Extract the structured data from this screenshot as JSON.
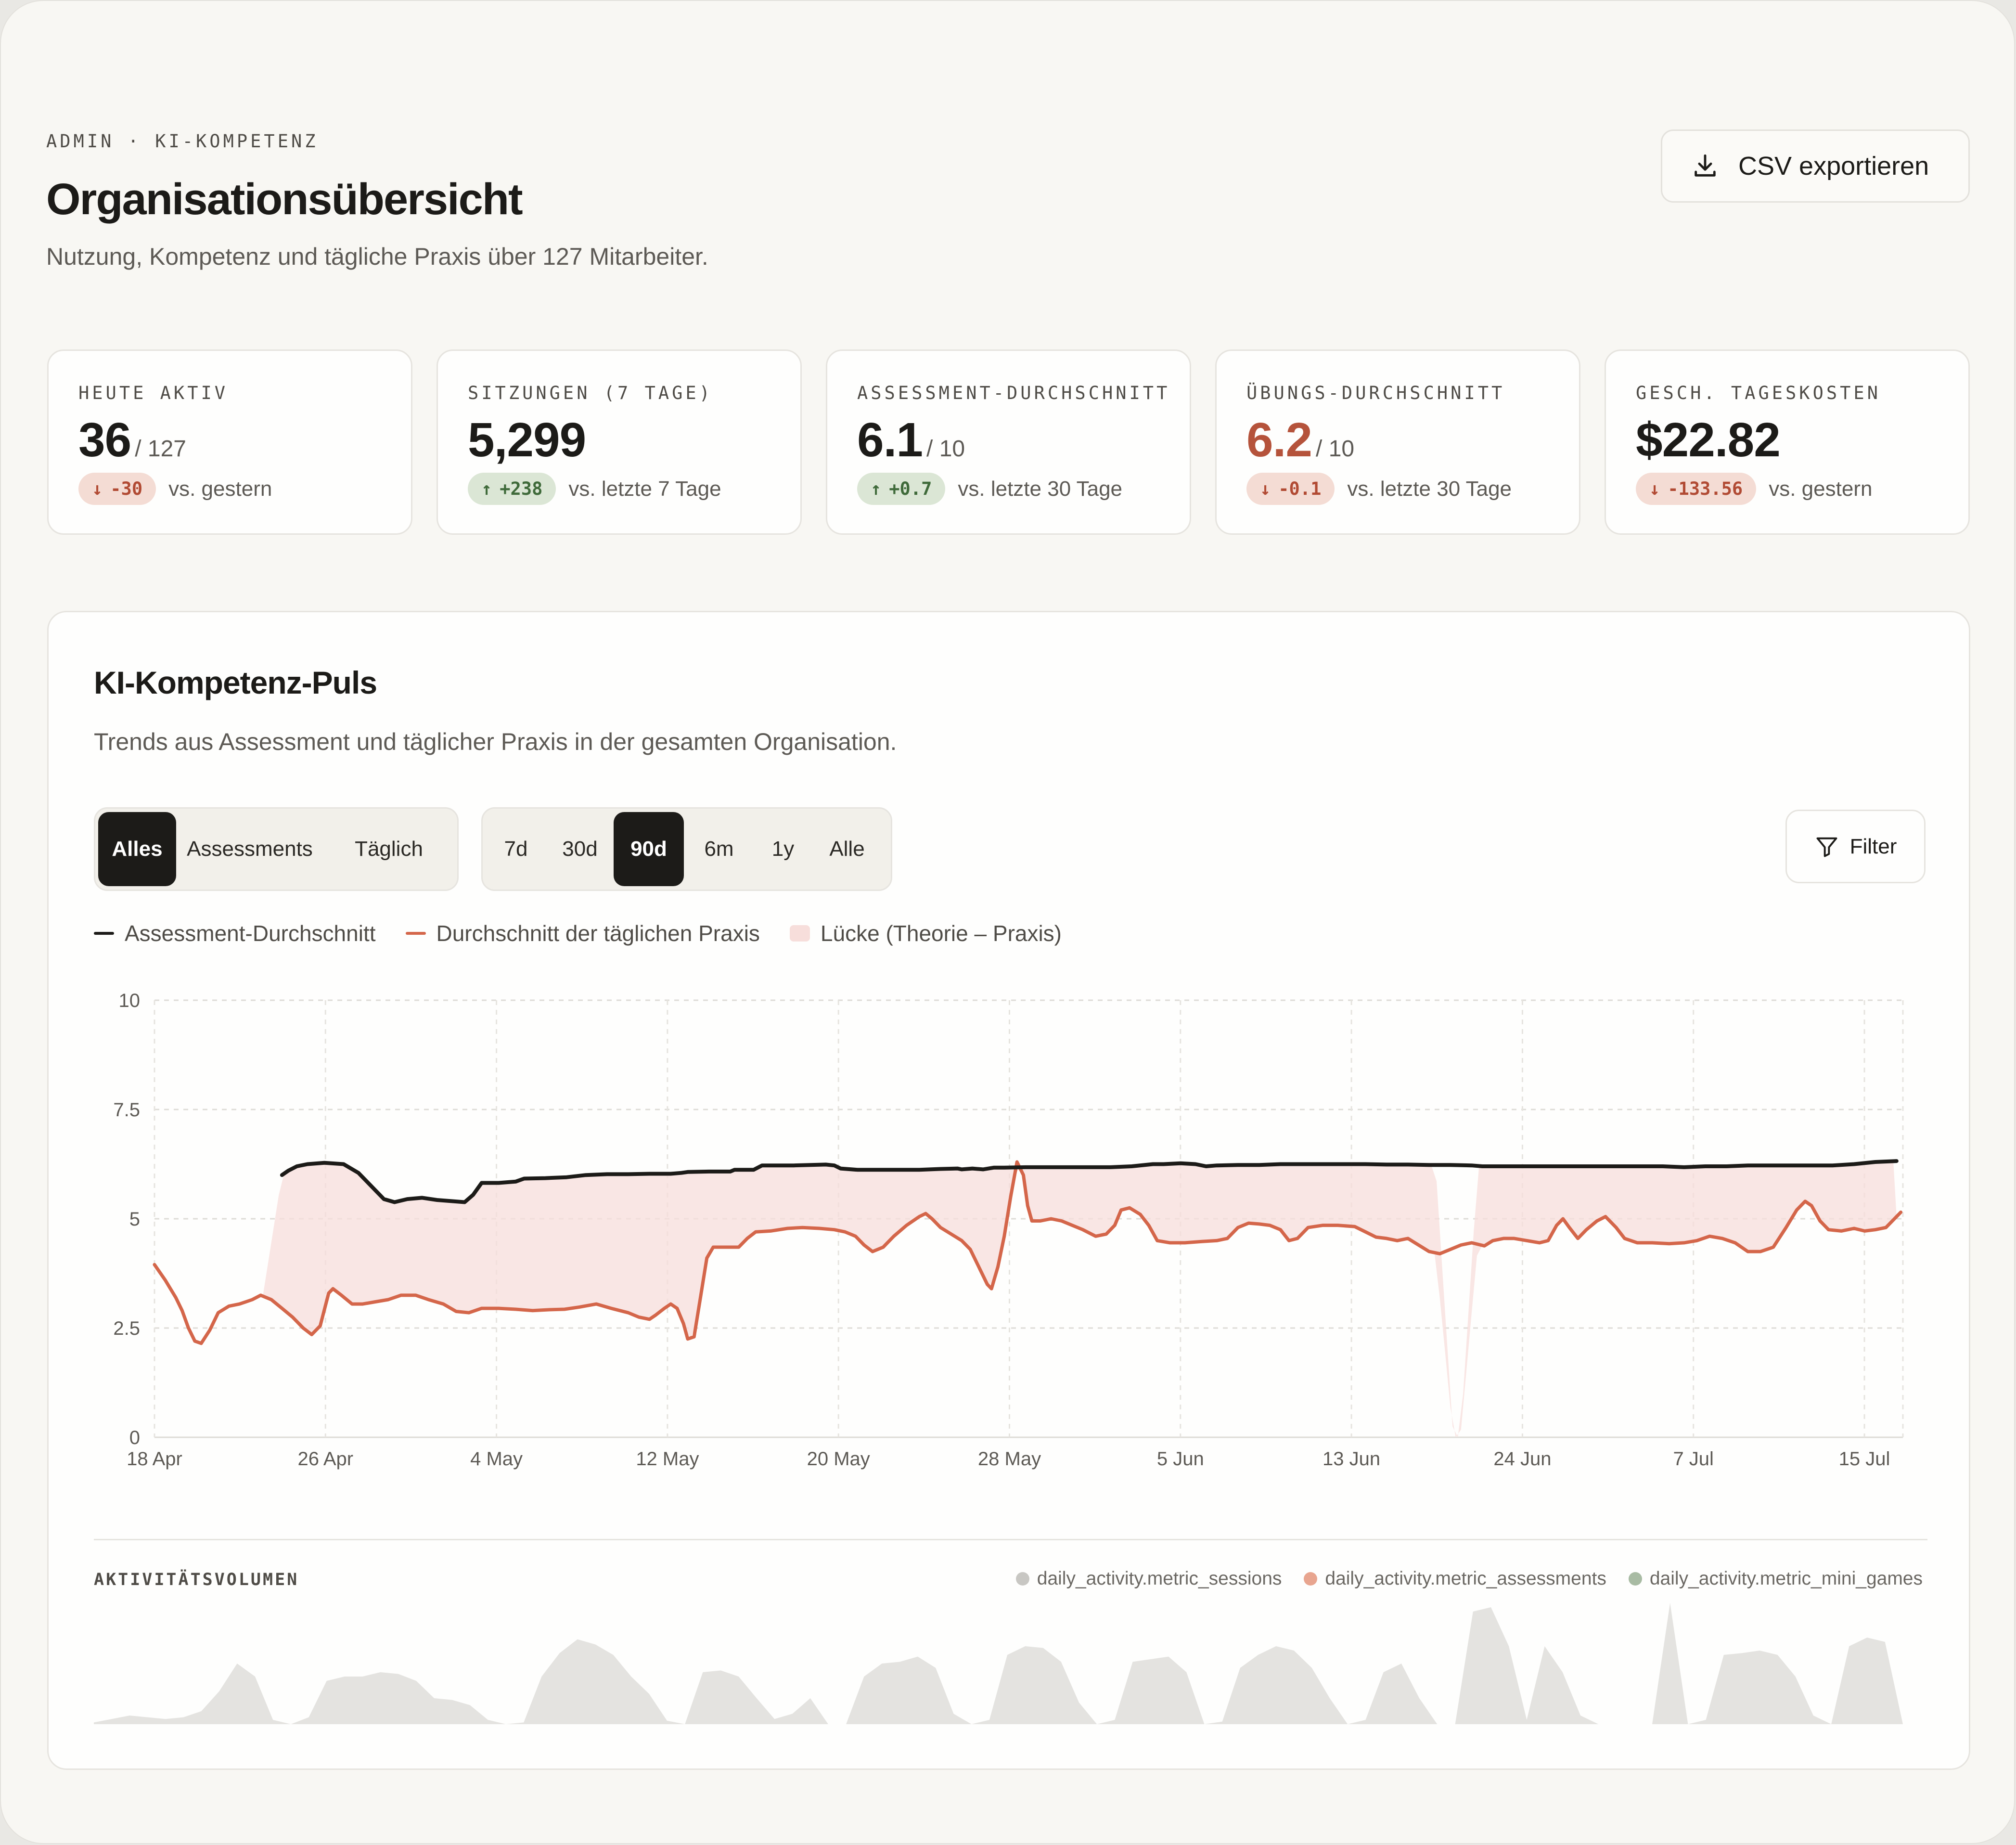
{
  "header": {
    "eyebrow": "ADMIN · KI-KOMPETENZ",
    "title": "Organisationsübersicht",
    "subtitle": "Nutzung, Kompetenz und tägliche Praxis über 127 Mitarbeiter.",
    "export_label": "CSV exportieren"
  },
  "kpis": [
    {
      "label": "HEUTE AKTIV",
      "value": "36",
      "denom": "/ 127",
      "delta": "-30",
      "direction": "down",
      "compare": "vs. gestern"
    },
    {
      "label": "SITZUNGEN (7 TAGE)",
      "value": "5,299",
      "denom": "",
      "delta": "+238",
      "direction": "up",
      "compare": "vs. letzte 7 Tage"
    },
    {
      "label": "ASSESSMENT-DURCHSCHNITT",
      "value": "6.1",
      "denom": "/ 10",
      "delta": "+0.7",
      "direction": "up",
      "compare": "vs. letzte 30 Tage"
    },
    {
      "label": "ÜBUNGS-DURCHSCHNITT",
      "value": "6.2",
      "denom": "/ 10",
      "delta": "-0.1",
      "direction": "down",
      "compare": "vs. letzte 30 Tage"
    },
    {
      "label": "GESCH. TAGESKOSTEN",
      "value": "$22.82",
      "denom": "",
      "delta": "-133.56",
      "direction": "down",
      "compare": "vs. gestern"
    }
  ],
  "colors": {
    "assessment_line": "#1c1b18",
    "practice_line": "#d4664a",
    "gap_fill": "#f7dedb",
    "warn_value": "#b5533b",
    "activity_fill": "#e4e3e0"
  },
  "panel": {
    "title": "KI-Kompetenz-Puls",
    "subtitle": "Trends aus Assessment und täglicher Praxis in der gesamten Organisation.",
    "type_filters": [
      "Alles",
      "Assessments",
      "Täglich"
    ],
    "type_active": "Alles",
    "range_filters": [
      "7d",
      "30d",
      "90d",
      "6m",
      "1y",
      "Alle"
    ],
    "range_active": "90d",
    "filter_label": "Filter",
    "legend": [
      "Assessment-Durchschnitt",
      "Durchschnitt der täglichen Praxis",
      "Lücke (Theorie – Praxis)"
    ],
    "activity_title": "AKTIVITÄTSVOLUMEN",
    "activity_legend": [
      "daily_activity.metric_sessions",
      "daily_activity.metric_assessments",
      "daily_activity.metric_mini_games"
    ],
    "activity_legend_colors": [
      "#c8c7c3",
      "#e8a58f",
      "#a8bba3"
    ]
  },
  "chart_data": {
    "type": "line",
    "y_ticks": [
      "0",
      "2.5",
      "5",
      "7.5",
      "10"
    ],
    "ylim": [
      0,
      10
    ],
    "x_ticks": [
      "18 Apr",
      "26 Apr",
      "4 May",
      "12 May",
      "20 May",
      "28 May",
      "5 Jun",
      "13 Jun",
      "24 Jun",
      "7 Jul",
      "15 Jul"
    ],
    "x_range_days": [
      0,
      82.3
    ],
    "grid": true,
    "series": [
      {
        "name": "Assessment-Durchschnitt",
        "points": [
          [
            6.0,
            6.0
          ],
          [
            6.3,
            6.1
          ],
          [
            6.7,
            6.2
          ],
          [
            7.2,
            6.25
          ],
          [
            8.0,
            6.28
          ],
          [
            8.9,
            6.25
          ],
          [
            9.6,
            6.05
          ],
          [
            10.2,
            5.75
          ],
          [
            10.8,
            5.45
          ],
          [
            11.3,
            5.38
          ],
          [
            11.9,
            5.45
          ],
          [
            12.6,
            5.48
          ],
          [
            13.3,
            5.43
          ],
          [
            14.1,
            5.4
          ],
          [
            14.6,
            5.38
          ],
          [
            15.0,
            5.55
          ],
          [
            15.4,
            5.82
          ],
          [
            16.2,
            5.82
          ],
          [
            17.0,
            5.85
          ],
          [
            17.4,
            5.92
          ],
          [
            18.4,
            5.93
          ],
          [
            19.4,
            5.95
          ],
          [
            20.3,
            6.0
          ],
          [
            21.3,
            6.02
          ],
          [
            22.3,
            6.02
          ],
          [
            23.3,
            6.03
          ],
          [
            24.3,
            6.03
          ],
          [
            24.8,
            6.05
          ],
          [
            25.1,
            6.07
          ],
          [
            26.1,
            6.08
          ],
          [
            27.1,
            6.08
          ],
          [
            27.3,
            6.12
          ],
          [
            28.2,
            6.12
          ],
          [
            28.6,
            6.22
          ],
          [
            30.1,
            6.22
          ],
          [
            31.6,
            6.24
          ],
          [
            32.0,
            6.22
          ],
          [
            32.3,
            6.15
          ],
          [
            33.1,
            6.12
          ],
          [
            34.1,
            6.12
          ],
          [
            35.1,
            6.12
          ],
          [
            36.0,
            6.12
          ],
          [
            37.0,
            6.14
          ],
          [
            37.8,
            6.15
          ],
          [
            38.0,
            6.13
          ],
          [
            38.5,
            6.15
          ],
          [
            39.0,
            6.13
          ],
          [
            39.5,
            6.17
          ],
          [
            40.0,
            6.17
          ],
          [
            41.0,
            6.18
          ],
          [
            42.0,
            6.18
          ],
          [
            43.0,
            6.18
          ],
          [
            44.0,
            6.18
          ],
          [
            45.0,
            6.18
          ],
          [
            46.0,
            6.2
          ],
          [
            47.0,
            6.25
          ],
          [
            47.5,
            6.25
          ],
          [
            48.3,
            6.27
          ],
          [
            49.0,
            6.25
          ],
          [
            49.5,
            6.2
          ],
          [
            50.0,
            6.22
          ],
          [
            51.0,
            6.23
          ],
          [
            52.0,
            6.23
          ],
          [
            53.0,
            6.25
          ],
          [
            54.0,
            6.25
          ],
          [
            55.0,
            6.25
          ],
          [
            56.0,
            6.25
          ],
          [
            57.0,
            6.25
          ],
          [
            58.0,
            6.24
          ],
          [
            59.0,
            6.24
          ],
          [
            60.0,
            6.23
          ],
          [
            61.0,
            6.23
          ],
          [
            62.0,
            6.22
          ],
          [
            62.5,
            6.2
          ],
          [
            63.0,
            6.2
          ],
          [
            64.0,
            6.2
          ],
          [
            65.0,
            6.2
          ],
          [
            66.0,
            6.2
          ],
          [
            67.0,
            6.2
          ],
          [
            68.0,
            6.2
          ],
          [
            69.0,
            6.2
          ],
          [
            70.0,
            6.2
          ],
          [
            71.0,
            6.2
          ],
          [
            72.0,
            6.18
          ],
          [
            73.0,
            6.2
          ],
          [
            74.0,
            6.2
          ],
          [
            75.0,
            6.22
          ],
          [
            76.0,
            6.22
          ],
          [
            77.0,
            6.22
          ],
          [
            78.0,
            6.22
          ],
          [
            79.0,
            6.22
          ],
          [
            80.0,
            6.25
          ],
          [
            81.0,
            6.3
          ],
          [
            82.0,
            6.32
          ]
        ]
      },
      {
        "name": "Durchschnitt der täglichen Praxis",
        "points": [
          [
            0.0,
            3.95
          ],
          [
            0.5,
            3.6
          ],
          [
            1.0,
            3.2
          ],
          [
            1.3,
            2.9
          ],
          [
            1.6,
            2.5
          ],
          [
            1.9,
            2.2
          ],
          [
            2.2,
            2.15
          ],
          [
            2.6,
            2.45
          ],
          [
            3.0,
            2.85
          ],
          [
            3.5,
            3.0
          ],
          [
            4.0,
            3.05
          ],
          [
            4.6,
            3.15
          ],
          [
            5.0,
            3.25
          ],
          [
            5.5,
            3.15
          ],
          [
            6.0,
            2.95
          ],
          [
            6.5,
            2.75
          ],
          [
            7.0,
            2.5
          ],
          [
            7.4,
            2.35
          ],
          [
            7.8,
            2.55
          ],
          [
            8.2,
            3.3
          ],
          [
            8.4,
            3.4
          ],
          [
            8.8,
            3.25
          ],
          [
            9.3,
            3.05
          ],
          [
            9.8,
            3.05
          ],
          [
            10.4,
            3.1
          ],
          [
            11.0,
            3.15
          ],
          [
            11.6,
            3.25
          ],
          [
            12.3,
            3.25
          ],
          [
            12.9,
            3.15
          ],
          [
            13.6,
            3.05
          ],
          [
            14.2,
            2.88
          ],
          [
            14.8,
            2.85
          ],
          [
            15.4,
            2.95
          ],
          [
            16.2,
            2.95
          ],
          [
            17.0,
            2.93
          ],
          [
            17.8,
            2.9
          ],
          [
            18.6,
            2.92
          ],
          [
            19.3,
            2.93
          ],
          [
            20.0,
            2.98
          ],
          [
            20.8,
            3.05
          ],
          [
            21.5,
            2.95
          ],
          [
            22.3,
            2.85
          ],
          [
            22.8,
            2.75
          ],
          [
            23.3,
            2.7
          ],
          [
            23.6,
            2.8
          ],
          [
            24.0,
            2.95
          ],
          [
            24.3,
            3.05
          ],
          [
            24.6,
            2.95
          ],
          [
            24.9,
            2.6
          ],
          [
            25.1,
            2.25
          ],
          [
            25.4,
            2.3
          ],
          [
            25.7,
            3.2
          ],
          [
            26.0,
            4.1
          ],
          [
            26.3,
            4.35
          ],
          [
            27.0,
            4.35
          ],
          [
            27.5,
            4.35
          ],
          [
            27.9,
            4.55
          ],
          [
            28.3,
            4.7
          ],
          [
            29.0,
            4.72
          ],
          [
            29.8,
            4.78
          ],
          [
            30.5,
            4.8
          ],
          [
            31.3,
            4.78
          ],
          [
            32.0,
            4.75
          ],
          [
            32.5,
            4.7
          ],
          [
            33.0,
            4.6
          ],
          [
            33.4,
            4.4
          ],
          [
            33.8,
            4.25
          ],
          [
            34.3,
            4.35
          ],
          [
            34.8,
            4.6
          ],
          [
            35.4,
            4.85
          ],
          [
            36.0,
            5.05
          ],
          [
            36.3,
            5.12
          ],
          [
            36.6,
            5.0
          ],
          [
            37.0,
            4.8
          ],
          [
            37.5,
            4.65
          ],
          [
            38.0,
            4.5
          ],
          [
            38.4,
            4.3
          ],
          [
            38.8,
            3.9
          ],
          [
            39.2,
            3.5
          ],
          [
            39.4,
            3.4
          ],
          [
            39.7,
            3.9
          ],
          [
            40.0,
            4.6
          ],
          [
            40.3,
            5.5
          ],
          [
            40.6,
            6.3
          ],
          [
            40.9,
            6.0
          ],
          [
            41.1,
            5.3
          ],
          [
            41.3,
            4.95
          ],
          [
            41.7,
            4.95
          ],
          [
            42.2,
            5.0
          ],
          [
            42.7,
            4.95
          ],
          [
            43.2,
            4.85
          ],
          [
            43.7,
            4.75
          ],
          [
            44.3,
            4.6
          ],
          [
            44.8,
            4.65
          ],
          [
            45.2,
            4.85
          ],
          [
            45.5,
            5.2
          ],
          [
            45.9,
            5.25
          ],
          [
            46.4,
            5.1
          ],
          [
            46.8,
            4.85
          ],
          [
            47.2,
            4.5
          ],
          [
            47.8,
            4.45
          ],
          [
            48.5,
            4.45
          ],
          [
            49.3,
            4.48
          ],
          [
            50.0,
            4.5
          ],
          [
            50.5,
            4.55
          ],
          [
            51.0,
            4.8
          ],
          [
            51.5,
            4.9
          ],
          [
            52.0,
            4.88
          ],
          [
            52.5,
            4.85
          ],
          [
            53.0,
            4.75
          ],
          [
            53.4,
            4.5
          ],
          [
            53.8,
            4.55
          ],
          [
            54.3,
            4.8
          ],
          [
            55.0,
            4.85
          ],
          [
            55.7,
            4.85
          ],
          [
            56.5,
            4.82
          ],
          [
            57.0,
            4.7
          ],
          [
            57.5,
            4.58
          ],
          [
            58.0,
            4.55
          ],
          [
            58.5,
            4.5
          ],
          [
            59.0,
            4.55
          ],
          [
            59.5,
            4.4
          ],
          [
            60.0,
            4.25
          ],
          [
            60.5,
            4.2
          ],
          [
            61.0,
            4.3
          ],
          [
            61.5,
            4.4
          ],
          [
            62.0,
            4.45
          ],
          [
            62.6,
            4.38
          ],
          [
            63.0,
            4.5
          ],
          [
            63.5,
            4.55
          ],
          [
            64.0,
            4.55
          ],
          [
            64.6,
            4.5
          ],
          [
            65.2,
            4.45
          ],
          [
            65.6,
            4.5
          ],
          [
            66.0,
            4.85
          ],
          [
            66.3,
            5.0
          ],
          [
            66.6,
            4.8
          ],
          [
            67.0,
            4.55
          ],
          [
            67.4,
            4.75
          ],
          [
            67.9,
            4.95
          ],
          [
            68.3,
            5.05
          ],
          [
            68.8,
            4.8
          ],
          [
            69.2,
            4.55
          ],
          [
            69.8,
            4.45
          ],
          [
            70.5,
            4.45
          ],
          [
            71.3,
            4.43
          ],
          [
            72.0,
            4.45
          ],
          [
            72.6,
            4.5
          ],
          [
            73.2,
            4.6
          ],
          [
            73.8,
            4.55
          ],
          [
            74.4,
            4.45
          ],
          [
            75.0,
            4.25
          ],
          [
            75.6,
            4.25
          ],
          [
            76.2,
            4.35
          ],
          [
            76.8,
            4.8
          ],
          [
            77.3,
            5.2
          ],
          [
            77.7,
            5.4
          ],
          [
            78.0,
            5.3
          ],
          [
            78.4,
            4.95
          ],
          [
            78.8,
            4.75
          ],
          [
            79.4,
            4.72
          ],
          [
            80.0,
            4.78
          ],
          [
            80.5,
            4.72
          ],
          [
            81.0,
            4.75
          ],
          [
            81.5,
            4.8
          ],
          [
            82.0,
            5.05
          ],
          [
            82.2,
            5.15
          ]
        ]
      },
      {
        "name": "Lücke (Theorie – Praxis)",
        "kind": "area_between",
        "upper": "Assessment-Durchschnitt",
        "lower": "Durchschnitt der täglichen Praxis",
        "gap_dip_days": [
          60.3,
          61.3,
          62.3
        ]
      }
    ]
  },
  "activity_data": {
    "type": "area",
    "series_name": "daily_activity.metric_sessions",
    "values": [
      0.02,
      0.06,
      0.1,
      0.08,
      0.06,
      0.08,
      0.15,
      0.38,
      0.7,
      0.55,
      0.05,
      0.0,
      0.08,
      0.5,
      0.55,
      0.55,
      0.6,
      0.58,
      0.5,
      0.3,
      0.28,
      0.22,
      0.05,
      0.0,
      0.02,
      0.55,
      0.82,
      0.98,
      0.92,
      0.8,
      0.55,
      0.35,
      0.04,
      0.0,
      0.6,
      0.62,
      0.55,
      0.3,
      0.06,
      0.12,
      0.3,
      0.0,
      0.0,
      0.55,
      0.7,
      0.72,
      0.78,
      0.65,
      0.12,
      0.0,
      0.05,
      0.8,
      0.9,
      0.88,
      0.72,
      0.25,
      0.0,
      0.05,
      0.72,
      0.75,
      0.78,
      0.6,
      0.0,
      0.03,
      0.65,
      0.8,
      0.9,
      0.85,
      0.65,
      0.3,
      0.0,
      0.05,
      0.6,
      0.7,
      0.3,
      0.0,
      0.0,
      1.3,
      1.35,
      0.9,
      0.05,
      0.9,
      0.6,
      0.1,
      0.0,
      0.0,
      0.0,
      0.0,
      1.4,
      0.0,
      0.05,
      0.8,
      0.82,
      0.85,
      0.8,
      0.55,
      0.1,
      0.0,
      0.9,
      1.0,
      0.95,
      0.0
    ]
  }
}
